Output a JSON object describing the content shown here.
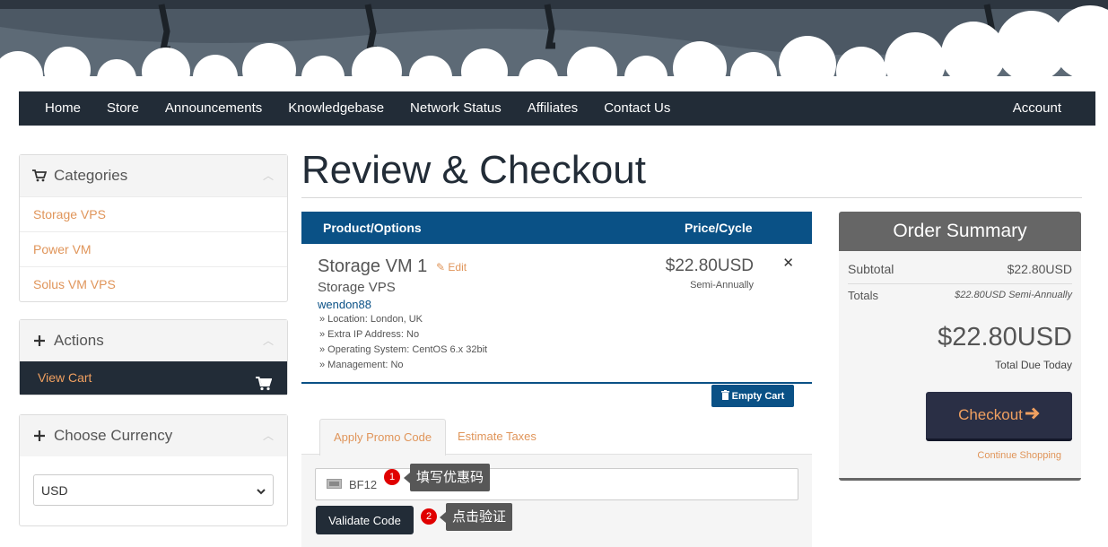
{
  "nav": {
    "items": [
      "Home",
      "Store",
      "Announcements",
      "Knowledgebase",
      "Network Status",
      "Affiliates",
      "Contact Us"
    ],
    "account": "Account"
  },
  "sidebar": {
    "categories": {
      "title": "Categories",
      "icon": "shopping-cart-icon",
      "links": [
        "Storage VPS",
        "Power VM",
        "Solus VM VPS"
      ]
    },
    "actions": {
      "title": "Actions",
      "icon": "plus-icon",
      "view_cart": "View Cart"
    },
    "currency": {
      "title": "Choose Currency",
      "icon": "plus-icon",
      "selected": "USD"
    }
  },
  "main": {
    "title": "Review & Checkout",
    "cart_headers": {
      "product": "Product/Options",
      "price": "Price/Cycle"
    },
    "item": {
      "name": "Storage VM 1",
      "edit": "Edit",
      "group": "Storage VPS",
      "domain": "wendon88",
      "options": [
        "» Location: London, UK",
        "» Extra IP Address: No",
        "» Operating System: CentOS 6.x 32bit",
        "» Management: No"
      ],
      "price": "$22.80USD",
      "cycle": "Semi-Annually"
    },
    "empty_cart": "Empty Cart",
    "tabs": [
      "Apply Promo Code",
      "Estimate Taxes"
    ],
    "promo": {
      "value": "BF12"
    },
    "validate_button": "Validate Code",
    "annotations": [
      {
        "num": "1",
        "text": "填写优惠码"
      },
      {
        "num": "2",
        "text": "点击验证"
      }
    ]
  },
  "summary": {
    "title": "Order Summary",
    "subtotal_label": "Subtotal",
    "subtotal_value": "$22.80USD",
    "totals_label": "Totals",
    "totals_value": "$22.80USD Semi-Annually",
    "total_due": "$22.80USD",
    "total_due_label": "Total Due Today",
    "checkout": "Checkout",
    "continue": "Continue Shopping"
  },
  "colors": {
    "navbar": "#222c37",
    "accent_orange": "#e0955a",
    "table_blue": "#0a5186",
    "summary_head": "#666666"
  }
}
